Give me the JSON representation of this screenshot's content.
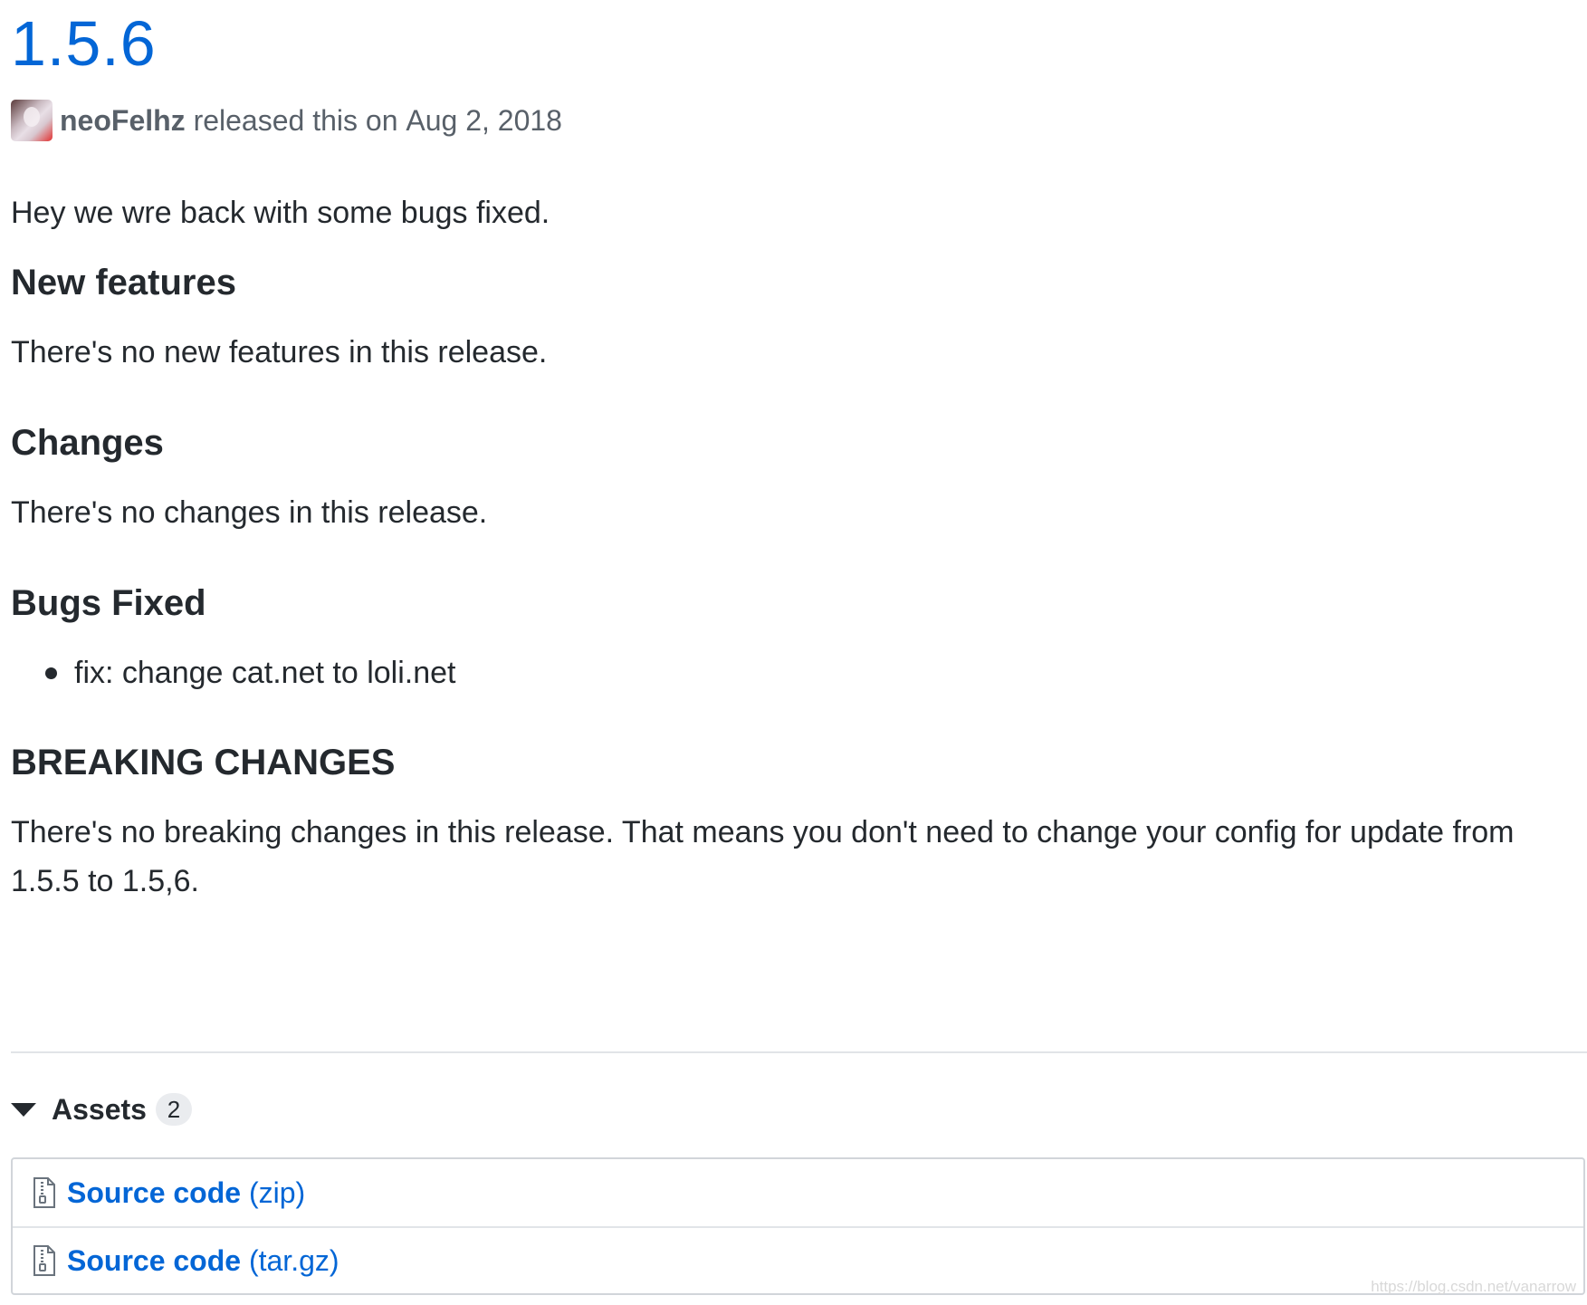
{
  "release": {
    "title": "1.5.6",
    "author": "neoFelhz",
    "released_text": "released this on",
    "date": "Aug 2, 2018"
  },
  "notes": {
    "intro": "Hey we wre back with some bugs fixed.",
    "new_features": {
      "heading": "New features",
      "body": "There's no new features in this release."
    },
    "changes": {
      "heading": "Changes",
      "body": "There's no changes in this release."
    },
    "bugs_fixed": {
      "heading": "Bugs Fixed",
      "items": [
        "fix: change cat.net to loli.net"
      ]
    },
    "breaking_changes": {
      "heading": "BREAKING CHANGES",
      "body": "There's no breaking changes in this release. That means you don't need to change your config for update from 1.5.5 to 1.5,6."
    }
  },
  "assets": {
    "label": "Assets",
    "count": "2",
    "items": [
      {
        "name": "Source code",
        "type": "(zip)"
      },
      {
        "name": "Source code",
        "type": "(tar.gz)"
      }
    ]
  },
  "watermark": "https://blog.csdn.net/vanarrow",
  "colors": {
    "link": "#0366d6",
    "text": "#24292e",
    "muted": "#586069"
  },
  "icons": {
    "caret": "triangle-down-icon",
    "file": "file-zip-icon"
  }
}
